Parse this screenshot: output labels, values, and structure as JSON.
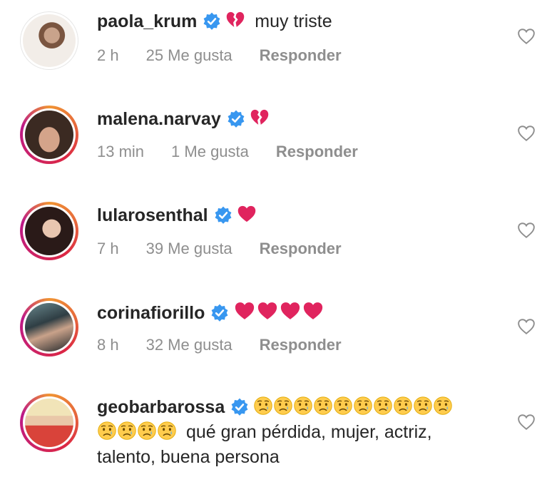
{
  "comments": [
    {
      "username": "paola_krum",
      "text": "muy triste",
      "time": "2 h",
      "likes": "25 Me gusta",
      "reply": "Responder",
      "ring": "plain"
    },
    {
      "username": "malena.narvay",
      "text": "",
      "time": "13 min",
      "likes": "1 Me gusta",
      "reply": "Responder",
      "ring": "story"
    },
    {
      "username": "lularosenthal",
      "text": "",
      "time": "7 h",
      "likes": "39 Me gusta",
      "reply": "Responder",
      "ring": "story"
    },
    {
      "username": "corinafiorillo",
      "text": "",
      "time": "8 h",
      "likes": "32 Me gusta",
      "reply": "Responder",
      "ring": "story"
    },
    {
      "username": "geobarbarossa",
      "text_line2": "qué gran pérdida, mujer, actriz,",
      "text_line3": "talento, buena persona",
      "ring": "story"
    }
  ],
  "icons": {
    "verified": "verified-badge-icon",
    "like": "heart-outline-icon",
    "broken_heart": "broken-heart-emoji",
    "red_heart": "red-heart-emoji",
    "sad_face": "sad-face-emoji"
  },
  "colors": {
    "verified_blue": "#3897f0",
    "heart_red": "#e0245e",
    "meta_gray": "#8e8e8e",
    "text": "#262626"
  }
}
